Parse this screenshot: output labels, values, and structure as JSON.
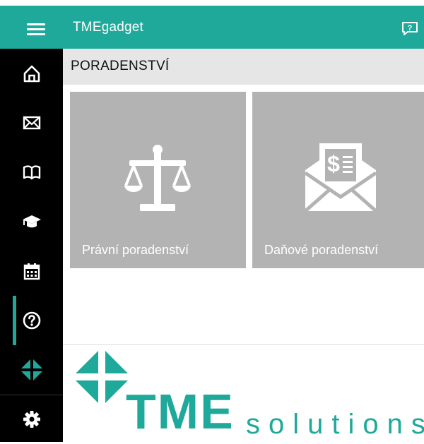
{
  "app": {
    "title": "TMEgadget"
  },
  "page": {
    "title": "PORADENSTVÍ"
  },
  "sidebar": {
    "items": [
      {
        "name": "home",
        "icon": "home-icon"
      },
      {
        "name": "mail",
        "icon": "envelope-icon"
      },
      {
        "name": "book",
        "icon": "book-icon"
      },
      {
        "name": "education",
        "icon": "graduation-cap-icon"
      },
      {
        "name": "calendar",
        "icon": "calendar-icon"
      },
      {
        "name": "help",
        "icon": "question-circle-icon",
        "active": true
      },
      {
        "name": "tme-logo",
        "icon": "tme-mark-icon"
      },
      {
        "name": "settings",
        "icon": "gear-icon"
      }
    ]
  },
  "tiles": [
    {
      "label": "Právní poradenství",
      "icon": "scales-icon"
    },
    {
      "label": "Daňové poradenství",
      "icon": "tax-envelope-icon"
    }
  ],
  "logo": {
    "brand": "TME",
    "suffix": "solutions"
  },
  "colors": {
    "accent": "#1fa99a",
    "sidebar": "#000000",
    "tile": "#b3b3b3",
    "header": "#e6e6e6"
  }
}
